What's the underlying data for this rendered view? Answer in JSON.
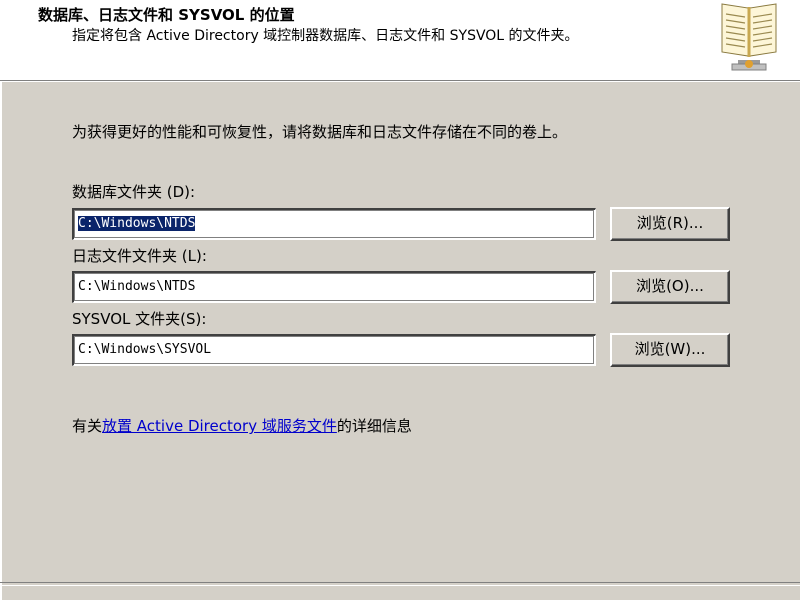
{
  "header": {
    "title": "数据库、日志文件和 SYSVOL 的位置",
    "subtitle": "指定将包含 Active Directory 域控制器数据库、日志文件和 SYSVOL 的文件夹。",
    "icon": "book-icon"
  },
  "main": {
    "instruction": "为获得更好的性能和可恢复性，请将数据库和日志文件存储在不同的卷上。",
    "fields": [
      {
        "label": "数据库文件夹 (D):",
        "value": "C:\\Windows\\NTDS",
        "selected": true,
        "button_label": "浏览(R)..."
      },
      {
        "label": "日志文件文件夹 (L):",
        "value": "C:\\Windows\\NTDS",
        "selected": false,
        "button_label": "浏览(O)..."
      },
      {
        "label": "SYSVOL 文件夹(S):",
        "value": "C:\\Windows\\SYSVOL",
        "selected": false,
        "button_label": "浏览(W)..."
      }
    ],
    "info": {
      "prefix": "有关",
      "link_text": "放置 Active Directory 域服务文件",
      "suffix": "的详细信息"
    }
  },
  "colors": {
    "dialog_bg": "#d4d0c8",
    "header_bg": "#ffffff",
    "link": "#0000cc",
    "selection": "#0a246a"
  }
}
